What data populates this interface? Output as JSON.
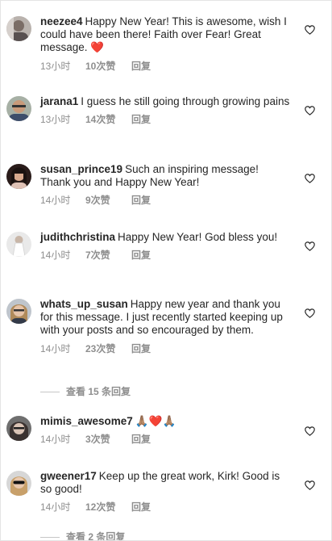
{
  "comments": [
    {
      "username": "neezee4",
      "text": "Happy New Year! This is awesome, wish I could have been there! Faith over Fear! Great message. ❤️",
      "time": "13小时",
      "likes": "10次赞",
      "reply": "回复"
    },
    {
      "username": "jarana1",
      "text": "I guess he still going through growing pains",
      "time": "13小时",
      "likes": "14次赞",
      "reply": "回复"
    },
    {
      "username": "susan_prince19",
      "text": "Such an inspiring message! Thank you and Happy New Year!",
      "time": "14小时",
      "likes": "9次赞",
      "reply": "回复"
    },
    {
      "username": "judithchristina",
      "text": "Happy New Year! God bless you!",
      "time": "14小时",
      "likes": "7次赞",
      "reply": "回复"
    },
    {
      "username": "whats_up_susan",
      "text": "Happy new year and thank you for this message. I just recently started keeping up with your posts and so encouraged by them.",
      "time": "14小时",
      "likes": "23次赞",
      "reply": "回复",
      "view_replies": "查看 15 条回复"
    },
    {
      "username": "mimis_awesome7",
      "text": "🙏🏽❤️🙏🏽",
      "time": "14小时",
      "likes": "3次赞",
      "reply": "回复"
    },
    {
      "username": "gweener17",
      "text": "Keep up the great work, Kirk! Good is so good!",
      "time": "14小时",
      "likes": "12次赞",
      "reply": "回复",
      "view_replies": "查看 2 条回复"
    }
  ],
  "icons": {
    "like": "heart-outline-icon"
  },
  "colors": {
    "text": "#262626",
    "secondary": "#8e8e8e",
    "like_heart": "#ed4956"
  }
}
